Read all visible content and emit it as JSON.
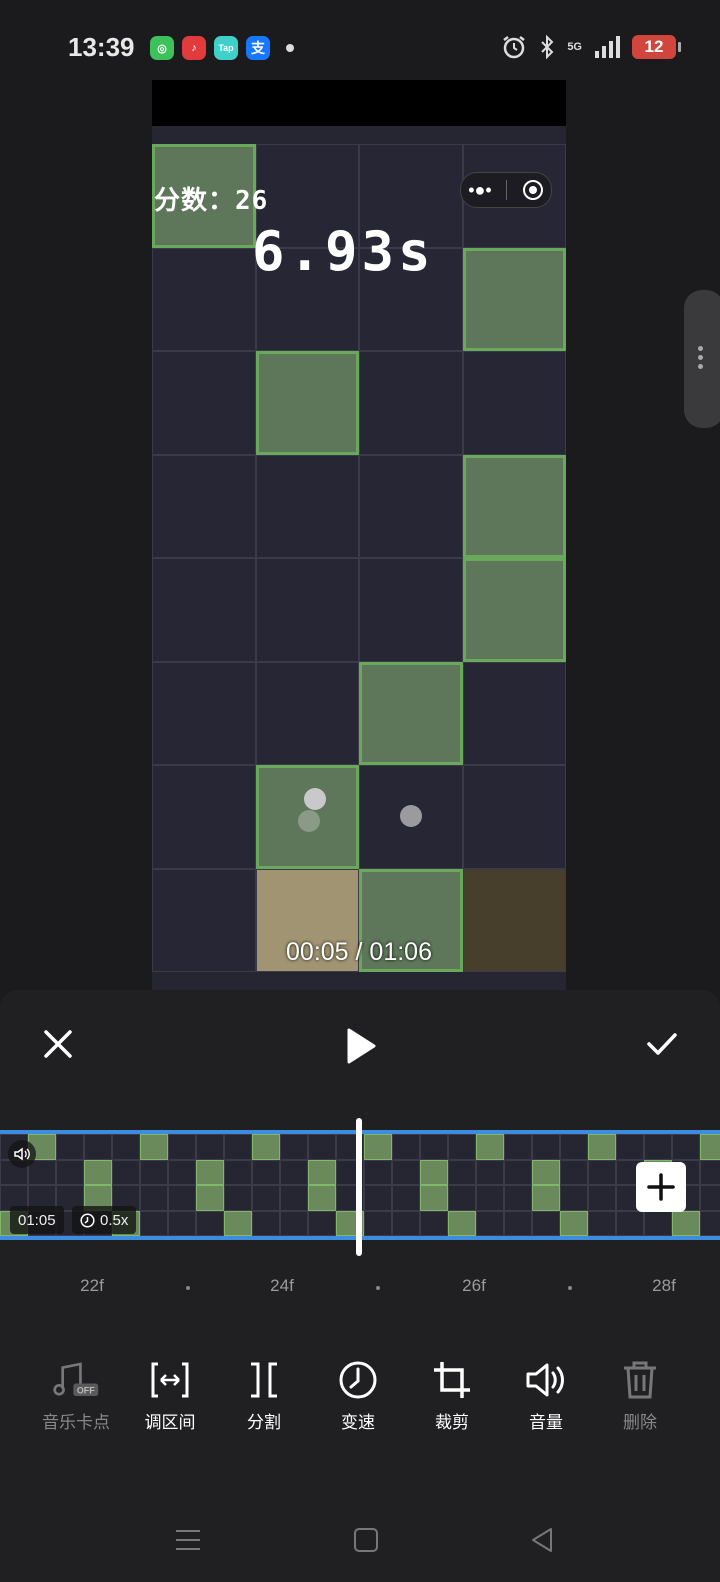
{
  "status": {
    "time": "13:39",
    "apps": [
      {
        "name": "wechat-icon",
        "color": "#3ec15a",
        "glyph": "◎"
      },
      {
        "name": "music-icon",
        "color": "#e23b3b",
        "glyph": "♪"
      },
      {
        "name": "taptap-icon",
        "color": "#3fd1c9",
        "glyph": "Tap"
      },
      {
        "name": "alipay-icon",
        "color": "#1677ff",
        "glyph": "支"
      }
    ],
    "network": "5G",
    "battery": "12"
  },
  "video": {
    "score_label": "分数：26",
    "timer": "6.93s",
    "playback": "00:05 / 01:06",
    "board": {
      "green_cells": [
        [
          0,
          0
        ],
        [
          3,
          1
        ],
        [
          1,
          2
        ],
        [
          3,
          3
        ],
        [
          3,
          4
        ],
        [
          2,
          5
        ],
        [
          1,
          6
        ],
        [
          2,
          7
        ]
      ],
      "tan_cells": [
        [
          1,
          7
        ]
      ],
      "brown_cells": [
        [
          3,
          7
        ]
      ]
    }
  },
  "timeline": {
    "duration": "01:05",
    "speed": "0.5x",
    "ruler": [
      "22f",
      "24f",
      "26f",
      "28f"
    ]
  },
  "tools": [
    {
      "label": "音乐卡点",
      "icon": "music-beat-icon",
      "dim": true
    },
    {
      "label": "调区间",
      "icon": "adjust-range-icon",
      "dim": false
    },
    {
      "label": "分割",
      "icon": "split-icon",
      "dim": false
    },
    {
      "label": "变速",
      "icon": "speed-icon",
      "dim": false
    },
    {
      "label": "裁剪",
      "icon": "crop-icon",
      "dim": false
    },
    {
      "label": "音量",
      "icon": "volume-icon",
      "dim": false
    },
    {
      "label": "删除",
      "icon": "delete-icon",
      "dim": true
    }
  ],
  "music_badge": "OFF"
}
